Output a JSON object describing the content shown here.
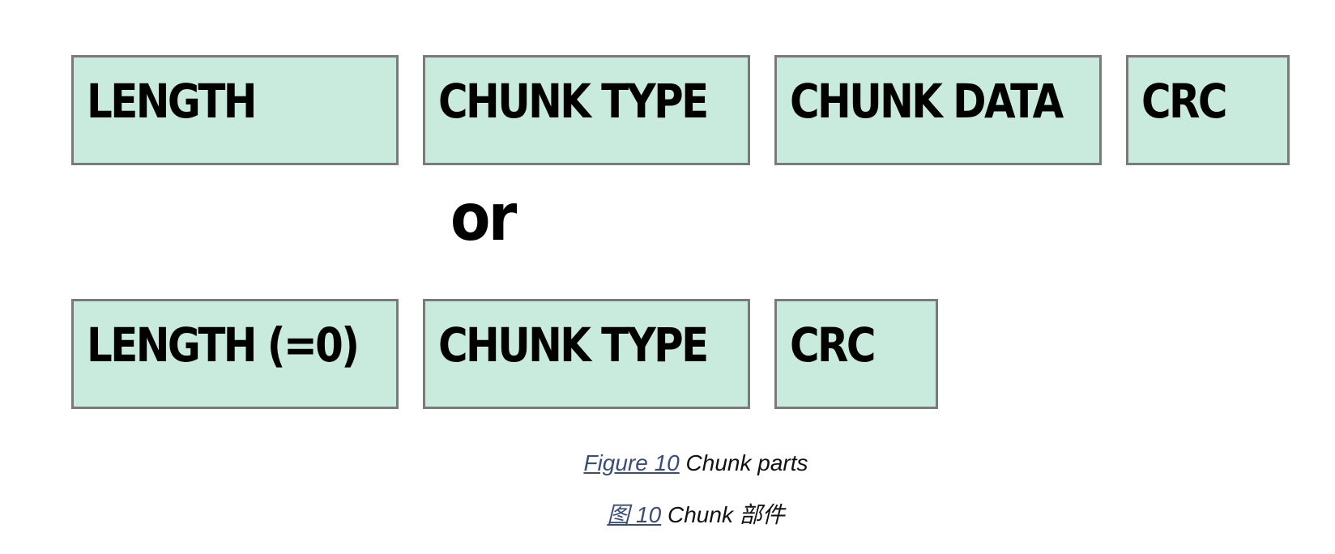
{
  "diagram": {
    "row1": [
      {
        "label": "LENGTH"
      },
      {
        "label": "CHUNK TYPE"
      },
      {
        "label": "CHUNK DATA"
      },
      {
        "label": "CRC"
      }
    ],
    "separator": "or",
    "row2": [
      {
        "label": "LENGTH (=0)"
      },
      {
        "label": "CHUNK TYPE"
      },
      {
        "label": "CRC"
      }
    ],
    "colors": {
      "box_fill": "#c8ebdd",
      "box_border": "#7a7a7a",
      "text": "#000000"
    }
  },
  "captions": [
    {
      "ref": "Figure 10",
      "text": "Chunk parts"
    },
    {
      "ref": "图 10",
      "text": "Chunk 部件"
    }
  ]
}
